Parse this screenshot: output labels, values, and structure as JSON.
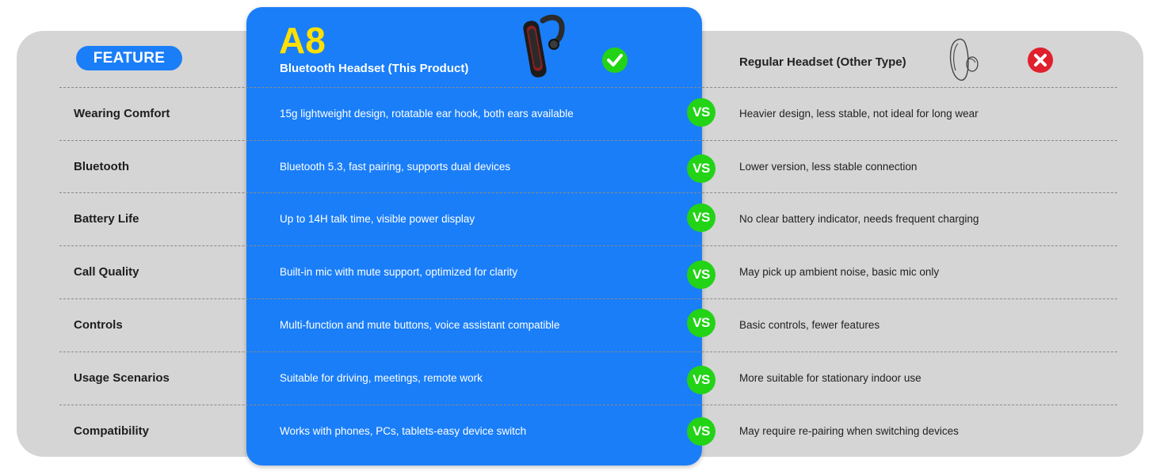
{
  "header": {
    "feature_label": "FEATURE",
    "product_name": "A8",
    "product_subtitle": "Bluetooth Headset (This Product)",
    "other_title": "Regular Headset (Other Type)",
    "check_icon": "check-circle-icon",
    "cross_icon": "x-circle-icon"
  },
  "vs_label": "VS",
  "colors": {
    "highlight": "#1a7ef8",
    "brand_yellow": "#ffe000",
    "vs_green": "#22d316",
    "cross_red": "#e0202d",
    "panel_gray": "#d5d5d5"
  },
  "rows": [
    {
      "feature": "Wearing Comfort",
      "a8": "15g lightweight design, rotatable ear hook, both ears available",
      "other": "Heavier design, less stable, not ideal for long wear"
    },
    {
      "feature": "Bluetooth",
      "a8": "Bluetooth 5.3, fast pairing, supports dual devices",
      "other": "Lower version, less stable connection"
    },
    {
      "feature": "Battery Life",
      "a8": "Up to 14H talk time, visible power display",
      "other": "No clear battery indicator, needs frequent charging"
    },
    {
      "feature": "Call Quality",
      "a8": "Built-in mic with mute support, optimized for clarity",
      "other": "May pick up ambient noise, basic mic only"
    },
    {
      "feature": "Controls",
      "a8": "Multi-function and mute buttons, voice assistant compatible",
      "other": "Basic controls, fewer features"
    },
    {
      "feature": "Usage Scenarios",
      "a8": "Suitable for driving, meetings, remote work",
      "other": "More suitable for stationary indoor use"
    },
    {
      "feature": "Compatibility",
      "a8": "Works with phones, PCs, tablets-easy device switch",
      "other": "May require re-pairing when switching devices"
    }
  ]
}
